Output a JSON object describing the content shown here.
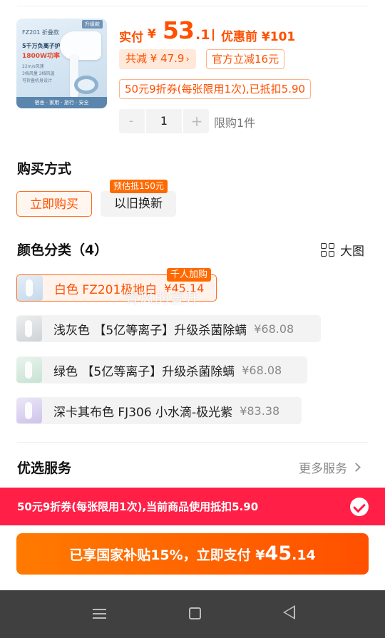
{
  "product": {
    "thumb": {
      "model": "FZ201 折叠款",
      "tag": "升级款",
      "line1": "5千万负离子护发",
      "line2": "1800W功率",
      "bullets": [
        "22m/s风速",
        "3档风量 2档风温",
        "可折叠机身设计"
      ],
      "footer": "宿舍 · 家用 · 旅行 · 安全"
    },
    "paid_label": "实付",
    "currency": "¥",
    "paid_int": "53",
    "paid_dec": ".1",
    "orig_label": "优惠前 ¥101",
    "total_discount": "共减 ¥ 47.9",
    "official_discount": "官方立减16元",
    "coupon_chip": "50元9折券(每张限用1次),已抵扣5.90",
    "quantity": "1",
    "minus": "-",
    "plus": "+",
    "limit": "限购1件"
  },
  "purchase": {
    "title": "购买方式",
    "buy_now": "立即购买",
    "trade_in": "以旧换新",
    "trade_in_badge": "预估抵150元"
  },
  "colors": {
    "title": "颜色分类（4）",
    "big_view": "大图",
    "hot_badge": "千人加购",
    "watermark": "青风的壹开",
    "items": [
      {
        "name": "白色 FZ201极地白",
        "price": "¥45.14",
        "selected": true
      },
      {
        "name": "浅灰色 【5亿等离子】升级杀菌除螨",
        "price": "¥68.08",
        "selected": false
      },
      {
        "name": "绿色 【5亿等离子】升级杀菌除螨",
        "price": "¥68.08",
        "selected": false
      },
      {
        "name": "深卡其布色 FJ306 小水滴-极光紫",
        "price": "¥83.38",
        "selected": false
      }
    ]
  },
  "service": {
    "title": "优选服务",
    "more": "更多服务"
  },
  "coupon_bar": {
    "text": "50元9折券(每张限用1次),当前商品使用抵扣5.90"
  },
  "pay": {
    "text": "已享国家补贴15%，立即支付 ¥",
    "int": "45",
    "dec": ".14"
  },
  "colors_theme": {
    "accent": "#ff5000",
    "coupon_red": "#ff1f47",
    "nav_bg": "#404040"
  }
}
